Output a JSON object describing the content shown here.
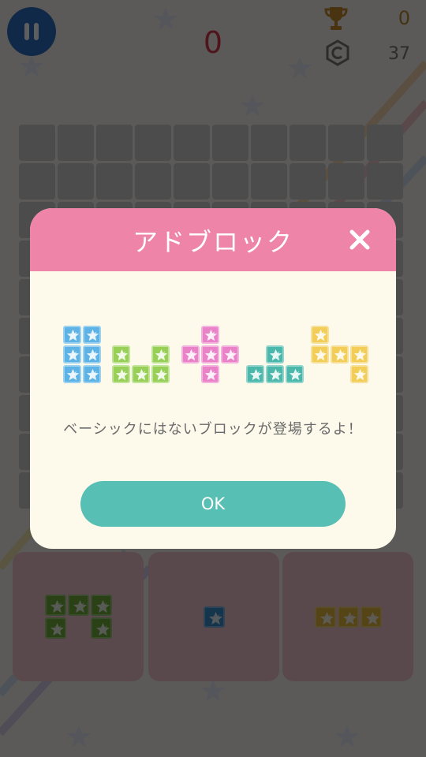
{
  "header": {
    "pause_icon": "pause-icon",
    "score": "0",
    "trophy_icon": "trophy-icon",
    "best_score": "0",
    "coin_icon": "copyright-coin-icon",
    "coins": "37"
  },
  "board": {
    "rows": 10,
    "cols": 10
  },
  "tray": {
    "pieces": [
      {
        "color": "#6fb03a",
        "cells": [
          [
            0,
            0
          ],
          [
            1,
            0
          ],
          [
            2,
            0
          ],
          [
            0,
            1
          ],
          [
            2,
            1
          ]
        ]
      },
      {
        "color": "#3a8fd0",
        "cells": [
          [
            0,
            0
          ]
        ]
      },
      {
        "color": "#e6b93c",
        "cells": [
          [
            0,
            0
          ],
          [
            1,
            0
          ],
          [
            2,
            0
          ]
        ]
      }
    ]
  },
  "dialog": {
    "title": "アドブロック",
    "close_icon": "close-icon",
    "message": "ベーシックにはないブロックが登場するよ！",
    "ok_label": "OK",
    "preview_blocks": [
      {
        "color": "#5db3e6",
        "cells": [
          [
            0,
            0
          ],
          [
            1,
            0
          ],
          [
            0,
            1
          ],
          [
            1,
            1
          ],
          [
            0,
            2
          ],
          [
            1,
            2
          ]
        ]
      },
      {
        "color": "#98d057",
        "cells": [
          [
            0,
            0
          ],
          [
            2,
            0
          ],
          [
            0,
            1
          ],
          [
            1,
            1
          ],
          [
            2,
            1
          ]
        ]
      },
      {
        "color": "#ea82c8",
        "cells": [
          [
            1,
            0
          ],
          [
            0,
            1
          ],
          [
            1,
            1
          ],
          [
            2,
            1
          ],
          [
            1,
            2
          ]
        ]
      },
      {
        "color": "#4bb8ab",
        "cells": [
          [
            1,
            0
          ],
          [
            0,
            1
          ],
          [
            1,
            1
          ],
          [
            2,
            1
          ]
        ]
      },
      {
        "color": "#f2ce58",
        "cells": [
          [
            0,
            0
          ],
          [
            0,
            1
          ],
          [
            1,
            1
          ],
          [
            2,
            1
          ],
          [
            2,
            2
          ]
        ]
      }
    ]
  },
  "colors": {
    "header_pink": "#ee85a9",
    "ok_teal": "#58bfb4",
    "score_red": "#d9384e",
    "pause_blue": "#2f6fc6"
  }
}
